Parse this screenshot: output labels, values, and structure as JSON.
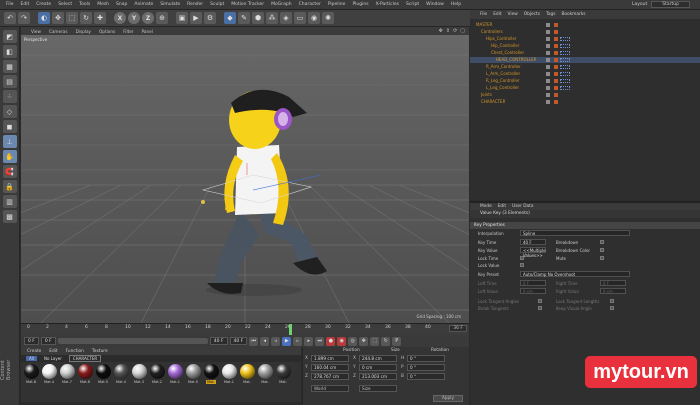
{
  "menubar": {
    "items": [
      "File",
      "Edit",
      "Create",
      "Select",
      "Tools",
      "Mesh",
      "Snap",
      "Animate",
      "Simulate",
      "Render",
      "Sculpt",
      "Motion Tracker",
      "MoGraph",
      "Character",
      "Pipeline",
      "Plugins",
      "X-Particles",
      "Script",
      "Window",
      "Help"
    ],
    "layout_label": "Layout",
    "layout_value": "Startup"
  },
  "toolbar": {
    "axis_x": "X",
    "axis_y": "Y",
    "axis_z": "Z"
  },
  "viewport": {
    "menu": [
      "View",
      "Cameras",
      "Display",
      "Options",
      "Filter",
      "Panel"
    ],
    "camera": "Perspective",
    "grid_spacing": "Grid Spacing : 100 cm"
  },
  "timeline": {
    "ticks": [
      "0",
      "2",
      "4",
      "6",
      "8",
      "10",
      "12",
      "14",
      "16",
      "18",
      "20",
      "22",
      "24",
      "26",
      "28",
      "30",
      "32",
      "34",
      "36",
      "38",
      "40"
    ],
    "end_frame": "36 F"
  },
  "transport": {
    "start": "0 F",
    "start2": "0 F",
    "end": "40 F",
    "end2": "40 F"
  },
  "materials": {
    "menu": [
      "Create",
      "Edit",
      "Function",
      "Texture"
    ],
    "filters": [
      "All",
      "No Layer",
      "CHARACTER"
    ],
    "items": [
      "Mat.8",
      "Mat.4",
      "Mat.7",
      "Mat.6",
      "Mat.5",
      "Mat.4",
      "Mat.3",
      "Mat.2",
      "Mat.1",
      "Mat.5",
      "Mat.",
      "Mat.1",
      "Mat.",
      "Mat.",
      "Mat."
    ],
    "colors": [
      "#1b1b1b",
      "#f4f4f4",
      "#cfcfcf",
      "#8a1c1c",
      "#0e0e0e",
      "#555555",
      "#d6d6d6",
      "#202020",
      "#a46ad6",
      "#9a9a9a",
      "#111111",
      "#e8e8e8",
      "#f0c21a",
      "#9e9e9e",
      "#3a3a3a"
    ],
    "selected_index": 10
  },
  "coords": {
    "headers": {
      "position": "Position",
      "size": "Size",
      "rotation": "Rotation"
    },
    "rows": [
      {
        "axis": "X",
        "pos": "1.899 cm",
        "size": "244.8 cm",
        "rot_axis": "H",
        "rot": "0 °"
      },
      {
        "axis": "Y",
        "pos": "160.04 cm",
        "size": "0 cm",
        "rot_axis": "P",
        "rot": "0 °"
      },
      {
        "axis": "Z",
        "pos": "278.767 cm",
        "size": "213.003 cm",
        "rot_axis": "B",
        "rot": "0 °"
      }
    ],
    "mode": "World",
    "size_mode": "Size",
    "apply": "Apply"
  },
  "object_manager": {
    "menu": [
      "File",
      "Edit",
      "View",
      "Objects",
      "Tags",
      "Bookmarks"
    ],
    "rows": [
      {
        "name": "MASTER",
        "indent": 0
      },
      {
        "name": "Controllers",
        "indent": 1
      },
      {
        "name": "Hips_Controller",
        "indent": 2
      },
      {
        "name": "Hip_Controller",
        "indent": 3
      },
      {
        "name": "Chest_Controller",
        "indent": 3
      },
      {
        "name": "HEAD_CONTROLLER",
        "indent": 4
      },
      {
        "name": "R_Arm_Controller",
        "indent": 2
      },
      {
        "name": "L_Arm_Controller",
        "indent": 2
      },
      {
        "name": "R_Leg_Controller",
        "indent": 2
      },
      {
        "name": "L_Leg_Controller",
        "indent": 2
      },
      {
        "name": "Joints",
        "indent": 1
      },
      {
        "name": "CHARACTER",
        "indent": 1
      }
    ],
    "selected_index": 5
  },
  "attributes": {
    "menu": [
      "Mode",
      "Edit",
      "User Data"
    ],
    "title": "Value Key (3 Elements)",
    "section": "Key Properties",
    "interpolation_label": "Interpolation",
    "interpolation_value": "Spline",
    "key_time_label": "Key Time",
    "key_time_value": "40 F",
    "key_value_label": "Key Value",
    "key_value_value": "<<Multiple Values>>",
    "lock_time_label": "Lock Time",
    "lock_value_label": "Lock Value",
    "breakdown_label": "Breakdown",
    "breakdown_color_label": "Breakdown Color",
    "mute_label": "Mute",
    "key_preset_label": "Key Preset",
    "key_preset_value": "Auto/Clamp No Overshoot",
    "left_time_label": "Left Time",
    "left_time_value": "0 F",
    "right_time_label": "Right Time",
    "right_time_value": "0 F",
    "left_value_label": "Left Value",
    "left_value_value": "0 cm",
    "right_value_label": "Right Value",
    "right_value_value": "0 cm",
    "lock_tangent_angles": "Lock Tangent Angles",
    "lock_tangent_lengths": "Lock Tangent Lengths",
    "break_tangents": "Break Tangents",
    "keep_visual_angle": "Keep Visual Angle"
  },
  "left_panel": {
    "content_label": "Content Browser"
  },
  "watermark": {
    "text": "mytour.vn"
  }
}
